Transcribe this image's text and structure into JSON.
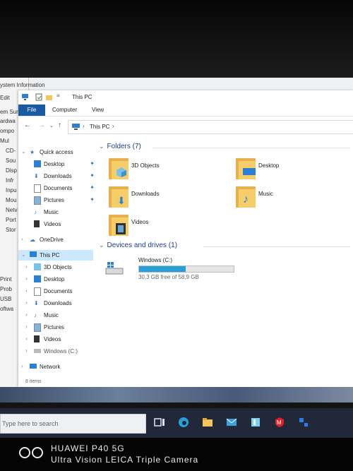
{
  "sysinfo": {
    "title": "ystem Information",
    "menu_edit": "Edit",
    "tree": [
      "em Sur",
      "ardwa",
      "ompo",
      "Mul",
      "CD-",
      "Sou",
      "Disp",
      "Infr",
      "Inpu",
      "Mou",
      "Netv",
      "Port",
      "Stor",
      "",
      "",
      "",
      "",
      "Print",
      "Prob",
      "USB",
      "oftwa"
    ]
  },
  "explorer": {
    "title": "This PC",
    "tabs": {
      "file": "File",
      "computer": "Computer",
      "view": "View"
    },
    "address": {
      "root": "This PC"
    },
    "nav": {
      "quick_access": "Quick access",
      "quick": [
        {
          "label": "Desktop"
        },
        {
          "label": "Downloads"
        },
        {
          "label": "Documents"
        },
        {
          "label": "Pictures"
        },
        {
          "label": "Music"
        },
        {
          "label": "Videos"
        }
      ],
      "onedrive": "OneDrive",
      "thispc": "This PC",
      "pc_items": [
        {
          "label": "3D Objects"
        },
        {
          "label": "Desktop"
        },
        {
          "label": "Documents"
        },
        {
          "label": "Downloads"
        },
        {
          "label": "Music"
        },
        {
          "label": "Pictures"
        },
        {
          "label": "Videos"
        },
        {
          "label": "Windows (C:)"
        }
      ],
      "network": "Network"
    },
    "folders_header": "Folders (7)",
    "folders": [
      {
        "label": "3D Objects"
      },
      {
        "label": "Desktop"
      },
      {
        "label": "Downloads"
      },
      {
        "label": "Music"
      },
      {
        "label": "Videos"
      }
    ],
    "devices_header": "Devices and drives (1)",
    "drive": {
      "label": "Windows (C:)",
      "free_text": "30,3 GB free of 58,9 GB",
      "used_fraction": 0.49
    },
    "status": "8 items"
  },
  "taskbar": {
    "search_placeholder": "Type here to search"
  },
  "watermark": {
    "line1": "HUAWEI P40 5G",
    "line2": "Ultra Vision LEICA Triple Camera"
  },
  "colors": {
    "accent": "#1a5aa0",
    "folder": "#f6cd6b",
    "selection": "#cce8ff",
    "drive_fill": "#26a0da"
  }
}
